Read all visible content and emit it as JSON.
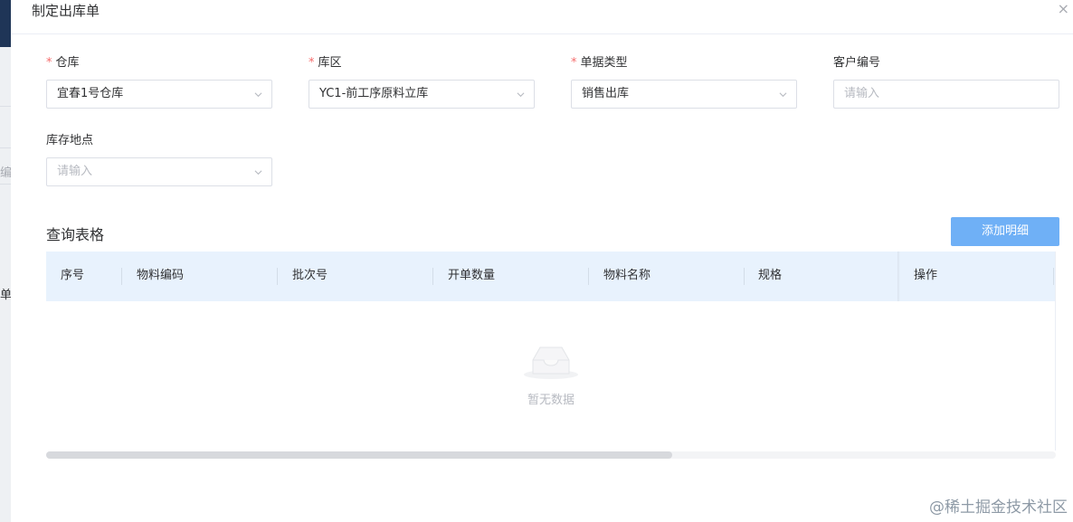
{
  "background": {
    "fragment_1": "编",
    "fragment_2": "单"
  },
  "dialog": {
    "title": "制定出库单",
    "close_glyph": "×"
  },
  "form": {
    "warehouse": {
      "label": "仓库",
      "required_mark": "*",
      "value": "宜春1号仓库"
    },
    "zone": {
      "label": "库区",
      "required_mark": "*",
      "value": "YC1-前工序原料立库"
    },
    "doc_type": {
      "label": "单据类型",
      "required_mark": "*",
      "value": "销售出库"
    },
    "customer_no": {
      "label": "客户编号",
      "placeholder": "请输入"
    },
    "location": {
      "label": "库存地点",
      "placeholder": "请输入"
    }
  },
  "table_section": {
    "title": "查询表格",
    "add_button": "添加明细",
    "columns": [
      "序号",
      "物料编码",
      "批次号",
      "开单数量",
      "物料名称",
      "规格",
      "操作"
    ],
    "empty_text": "暂无数据",
    "horizontal_scroll_fraction": 0.62
  },
  "watermark": "@稀土掘金技术社区",
  "colors": {
    "primary_button": "#6fb0f6",
    "table_header": "#e8f2fd",
    "required": "#f56c6c"
  },
  "icons": [
    "close-icon",
    "chevron-down-icon",
    "empty-inbox-icon"
  ]
}
